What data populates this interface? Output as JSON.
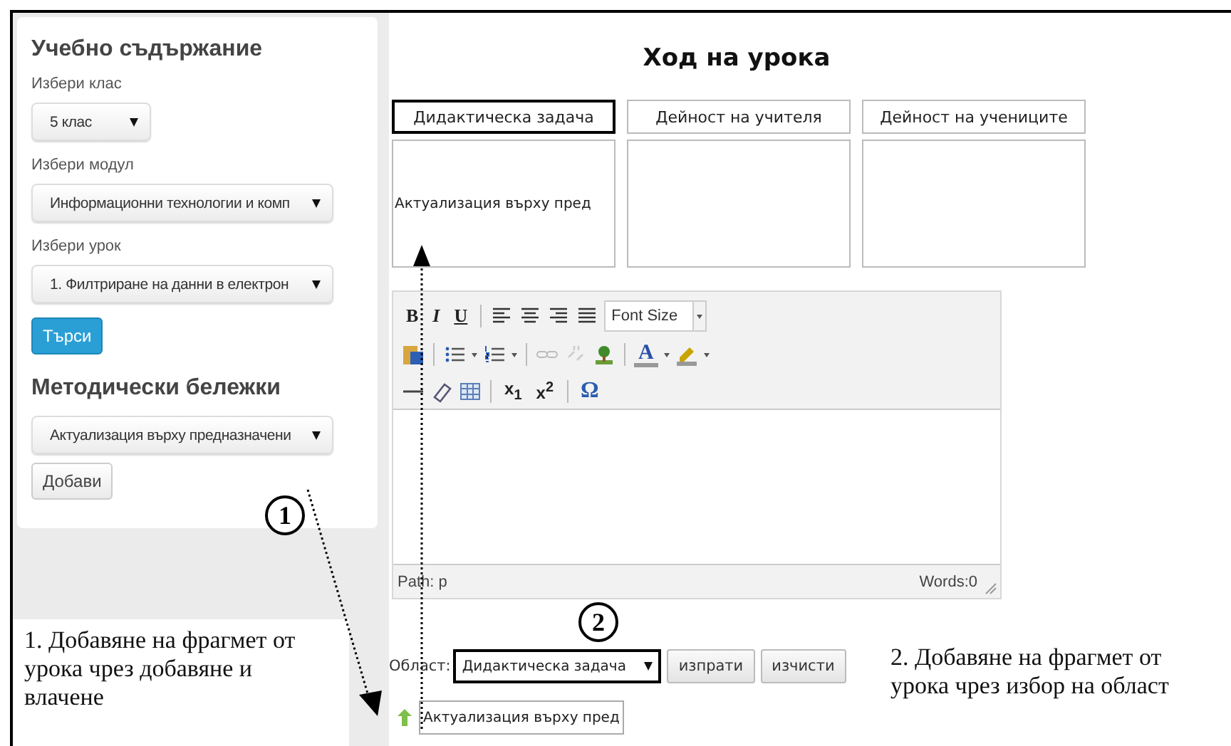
{
  "sidebar": {
    "title": "Учебно съдържание",
    "fields": [
      {
        "label": "Избери клас",
        "value": "5 клас",
        "kind": "short"
      },
      {
        "label": "Избери модул",
        "value": "Информационни технологии и комп",
        "kind": "wide"
      },
      {
        "label": "Избери урок",
        "value": "1. Филтриране на данни в електрон",
        "kind": "wide"
      }
    ],
    "search_button": "Търси",
    "notes_title": "Методически бележки",
    "notes_select": "Актуализация върху предназначени",
    "add_button": "Добави"
  },
  "lesson": {
    "title": "Ход на урока",
    "columns": [
      {
        "header": "Дидактическа задача",
        "highlighted": true,
        "content": "Актуализация върху пред"
      },
      {
        "header": "Дейност на учителя",
        "highlighted": false
      },
      {
        "header": "Дейност на учениците",
        "highlighted": false
      }
    ]
  },
  "editor": {
    "toolbar": [
      [
        {
          "kind": "bold",
          "text": "B"
        },
        {
          "kind": "italic",
          "text": "I"
        },
        {
          "kind": "underline",
          "text": "U"
        },
        {
          "kind": "sep"
        },
        {
          "kind": "align-left"
        },
        {
          "kind": "align-center"
        },
        {
          "kind": "align-right"
        },
        {
          "kind": "justify"
        },
        {
          "kind": "select",
          "placeholder": "Font Size"
        }
      ],
      [
        {
          "kind": "paste"
        },
        {
          "kind": "sep"
        },
        {
          "kind": "bullets"
        },
        {
          "kind": "dropdown"
        },
        {
          "kind": "numbers"
        },
        {
          "kind": "dropdown"
        },
        {
          "kind": "sep"
        },
        {
          "kind": "link"
        },
        {
          "kind": "unlink"
        },
        {
          "kind": "image"
        },
        {
          "kind": "sep"
        },
        {
          "kind": "color",
          "text": "A"
        },
        {
          "kind": "dropdown"
        },
        {
          "kind": "highlight"
        },
        {
          "kind": "dropdown"
        }
      ],
      [
        {
          "kind": "rule"
        },
        {
          "kind": "eraser"
        },
        {
          "kind": "table"
        },
        {
          "kind": "sep"
        },
        {
          "kind": "sub",
          "text": "x$_{1}$"
        },
        {
          "kind": "sup",
          "text": "x$^{2}$"
        },
        {
          "kind": "sep"
        },
        {
          "kind": "symbol",
          "text": "Ω"
        }
      ]
    ],
    "path": "Path: p",
    "words": "Words:0"
  },
  "area": {
    "label": "Област:",
    "select": "Дидактическа задача",
    "highlighted": true,
    "buttons": [
      "изпрати",
      "изчисти"
    ]
  },
  "fragment": "Актуализация върху пред",
  "annotations": [
    {
      "number": "1",
      "text": "1. Добавяне на фрагмет от урока чрез добавяне и влачене"
    },
    {
      "number": "2",
      "text": "2. Добавяне на фрагмет от урока чрез избор на област"
    }
  ]
}
